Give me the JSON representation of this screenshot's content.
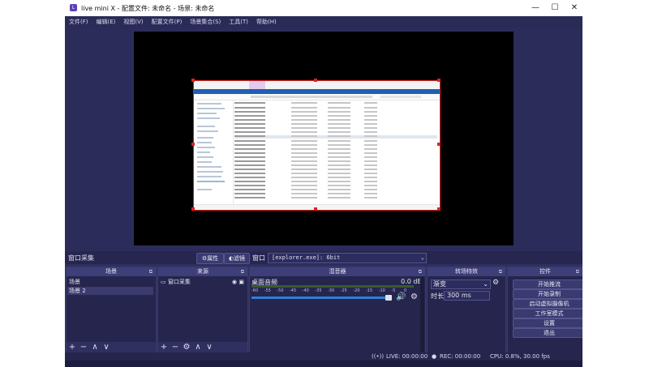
{
  "window": {
    "title": "live mini X - 配置文件: 未命名 - 场景: 未命名",
    "icon_text": "L",
    "minimize": "—",
    "maximize": "☐",
    "close": "✕"
  },
  "menu": [
    "文件(F)",
    "编辑(E)",
    "视图(V)",
    "配置文件(P)",
    "场景集合(S)",
    "工具(T)",
    "帮助(H)"
  ],
  "source_bar": {
    "label": "窗口采集",
    "properties_label": "⚙属性",
    "filters_label": "滤镜",
    "window_label": "窗口",
    "window_value": "[explorer.exe]: 6bit"
  },
  "docks": {
    "scenes": {
      "title": "场景",
      "items": [
        "场景",
        "场景 2"
      ]
    },
    "sources": {
      "title": "来源",
      "items": [
        "窗口采集"
      ]
    },
    "mixer": {
      "title": "混音器",
      "track_name": "桌面音频",
      "level": "0.0 dB",
      "volume_percent": 100,
      "scale": [
        "-60",
        "-55",
        "-50",
        "-45",
        "-40",
        "-35",
        "-30",
        "-25",
        "-20",
        "-15",
        "-10",
        "-5",
        "0"
      ]
    },
    "transitions": {
      "title": "转场特效",
      "transition": "渐变",
      "duration_label": "时长",
      "duration_value": "300 ms"
    },
    "controls": {
      "title": "控件",
      "buttons": [
        "开始推流",
        "开始录制",
        "启动虚拟摄像机",
        "工作室模式",
        "设置",
        "退出"
      ]
    }
  },
  "status": {
    "live": "LIVE: 00:00:00",
    "rec": "REC: 00:00:00",
    "cpu": "CPU: 0.8%, 30.00 fps"
  },
  "colors": {
    "background": "#2f2f5e",
    "accent": "#3e3e78",
    "selection": "#e02020",
    "meter": "#2f7fd8"
  }
}
